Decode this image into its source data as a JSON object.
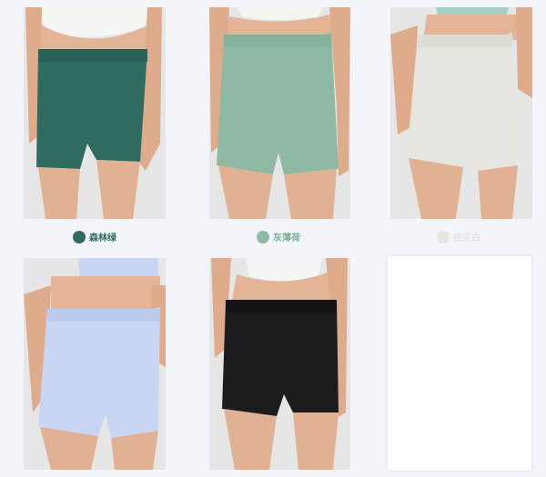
{
  "colors": {
    "forest_green": "#2f6b5e",
    "gray_mint": "#8fb9a5",
    "ivory_white": "#e6e5df",
    "light_blue": "#c9d6f3",
    "black": "#1c1c1e"
  },
  "products": [
    {
      "color_name": "森林绿",
      "swatch": "#2f6b5e",
      "label_color": "#2f6b5e"
    },
    {
      "color_name": "灰薄荷",
      "swatch": "#8fb9a5",
      "label_color": "#7fae98"
    },
    {
      "color_name": "白贝白",
      "swatch": "#e6e5df",
      "label_color": "#e3e3e3"
    },
    {
      "color_name": "",
      "swatch": "#c9d6f3"
    },
    {
      "color_name": "",
      "swatch": "#1c1c1e"
    }
  ]
}
